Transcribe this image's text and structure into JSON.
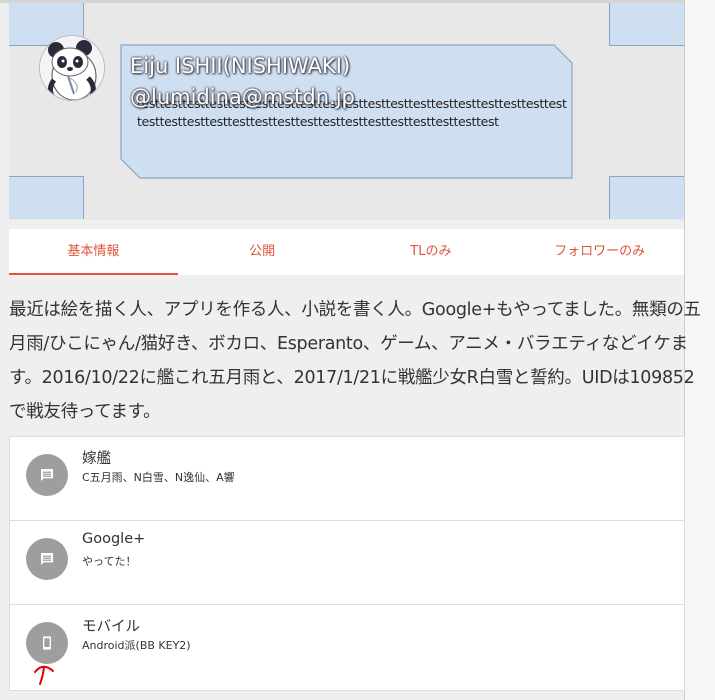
{
  "profile": {
    "display_name": "Eiju ISHII(NISHIWAKI)",
    "handle": "@lumidina@mstdn.jp",
    "bio_preview": "testtesttesttesttesttesttesttesttesttesttesttesttesttesttesttesttesttesttesttesttesttesttesttesttesttesttesttesttesttesttesttesttesttesttest",
    "avatar_icon": "panda-avatar-icon"
  },
  "tabs": [
    {
      "label": "基本情報",
      "active": true
    },
    {
      "label": "公開",
      "active": false
    },
    {
      "label": "TLのみ",
      "active": false
    },
    {
      "label": "フォロワーのみ",
      "active": false
    }
  ],
  "note": "最近は絵を描く人、アプリを作る人、小説を書く人。Google+もやってました。無類の五月雨/ひこにゃん/猫好き、ボカロ、Esperanto、ゲーム、アニメ・バラエティなどイケます。2016/10/22に艦これ五月雨と、2017/1/21に戦艦少女R白雪と誓約。UIDは109852で戦友待ってます。",
  "fields": [
    {
      "name": "嫁艦",
      "value": "C五月雨、N白雪、N逸仙、A響",
      "icon": "comment-icon"
    },
    {
      "name": "Google+",
      "value": "やってた！",
      "icon": "comment-icon"
    },
    {
      "name": "モバイル",
      "value": "Android派(BB KEY2)",
      "icon": "smartphone-icon"
    }
  ],
  "colors": {
    "accent": "#e0553b",
    "header_panel": "#cfdff2",
    "icon_circle": "#9e9e9e",
    "annotation": "#e00000"
  }
}
